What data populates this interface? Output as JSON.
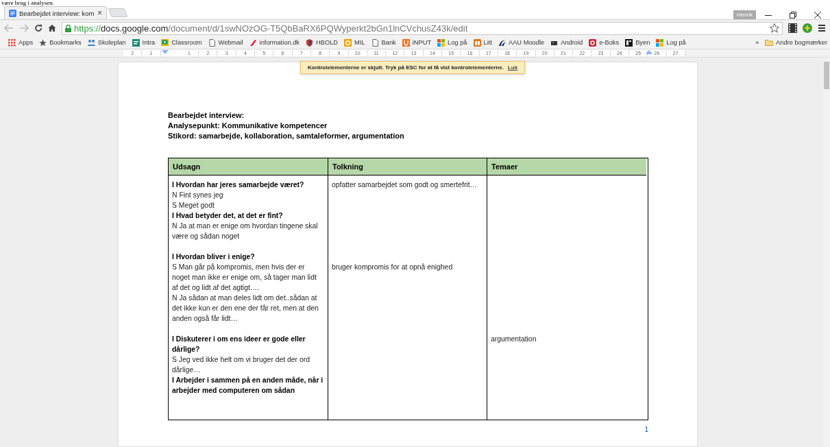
{
  "caption_above": "være brug i analysen.",
  "browser": {
    "tab": {
      "title": "Bearbejdet interview: kom",
      "close": "×"
    },
    "profile": "Henrik",
    "url": {
      "scheme": "https://",
      "host": "docs.google.com",
      "path": "/document/d/1swNOzOG-T5QbBaRX6PQWyperkt2bGn1lnCVchusZ43k/edit"
    },
    "bookmarks": [
      {
        "label": "Apps",
        "kind": "grid"
      },
      {
        "label": "Bookmarks",
        "kind": "star"
      },
      {
        "label": "Skoleplan",
        "kind": "people"
      },
      {
        "label": "Intra",
        "kind": "tile"
      },
      {
        "label": "Classroom",
        "kind": "board"
      },
      {
        "label": "Webmail",
        "kind": "page"
      },
      {
        "label": "information.dk",
        "kind": "pen"
      },
      {
        "label": "HBOLD",
        "kind": "shield"
      },
      {
        "label": "MIL",
        "kind": "office"
      },
      {
        "label": "Bank",
        "kind": "page"
      },
      {
        "label": "iNPUT",
        "kind": "hand"
      },
      {
        "label": "Log på",
        "kind": "windows"
      },
      {
        "label": "Litt",
        "kind": "book"
      },
      {
        "label": "AAU Moodle",
        "kind": "wave"
      },
      {
        "label": "Android",
        "kind": "chip"
      },
      {
        "label": "e-Boks",
        "kind": "ebox"
      },
      {
        "label": "Byen",
        "kind": "byen"
      },
      {
        "label": "Log på",
        "kind": "windows"
      }
    ],
    "more": "»",
    "other_bookmarks": "Andre bogmærker"
  },
  "ruler": [
    "2",
    "1",
    "1",
    "2",
    "3",
    "4",
    "5",
    "6",
    "7",
    "8",
    "9",
    "10",
    "11",
    "12",
    "13",
    "14",
    "15",
    "16",
    "17",
    "18",
    "19",
    "20",
    "21",
    "22",
    "23",
    "24",
    "25",
    "26",
    "27"
  ],
  "notice": {
    "text": "Kontrolelementerne er skjult. Tryk på ESC for at få vist kontrolelementerne.",
    "link": "Luk"
  },
  "heading": [
    "Bearbejdet interview:",
    "Analysepunkt: Kommunikative kompetencer",
    "Stikord: samarbejde, kollaboration, samtaleformer, argumentation"
  ],
  "table": {
    "columns": [
      "Udsagn",
      "Tolkning",
      "Temaer"
    ],
    "segments": [
      {
        "udsagn": [
          {
            "text": "I Hvordan har jeres samarbejde været?",
            "bold": true
          },
          {
            "text": "N Fint synes jeg",
            "bold": false
          },
          {
            "text": "S Meget godt",
            "bold": false
          },
          {
            "text": "I Hvad betyder det, at det er fint?",
            "bold": true
          },
          {
            "text": "N Ja at man er enige om hvordan tingene skal være og sådan noget",
            "bold": false
          }
        ],
        "tolkning": "opfatter samarbejdet som godt og smertefrit…",
        "gap_after": true
      },
      {
        "udsagn": [
          {
            "text": "I Hvordan bliver i enige?",
            "bold": true
          }
        ],
        "gap_after": false
      },
      {
        "udsagn": [
          {
            "text": "S Man går på kompromis, men hvis der er noget man ikke er enige om, så tager man lidt af det og lidt af det agtigt….",
            "bold": false
          },
          {
            "text": "N Ja sådan at man deles lidt om det..sådan at det ikke kun er den ene der får ret, men at den anden også får lidt…",
            "bold": false
          }
        ],
        "tolkning": "bruger kompromis for at opnå enighed",
        "gap_after": true
      },
      {
        "udsagn": [
          {
            "text": "I Diskuterer i om ens ideer er gode eller dårlige?",
            "bold": true
          }
        ],
        "temaer": "argumentation",
        "gap_after": false
      },
      {
        "udsagn": [
          {
            "text": "S Jeg ved ikke helt om vi bruger det der ord dårlige…",
            "bold": false
          },
          {
            "text": "I Arbejder i sammen på en anden måde, når i arbejder med computeren om sådan",
            "bold": true
          }
        ],
        "gap_after": true
      }
    ]
  },
  "page_number": "1"
}
